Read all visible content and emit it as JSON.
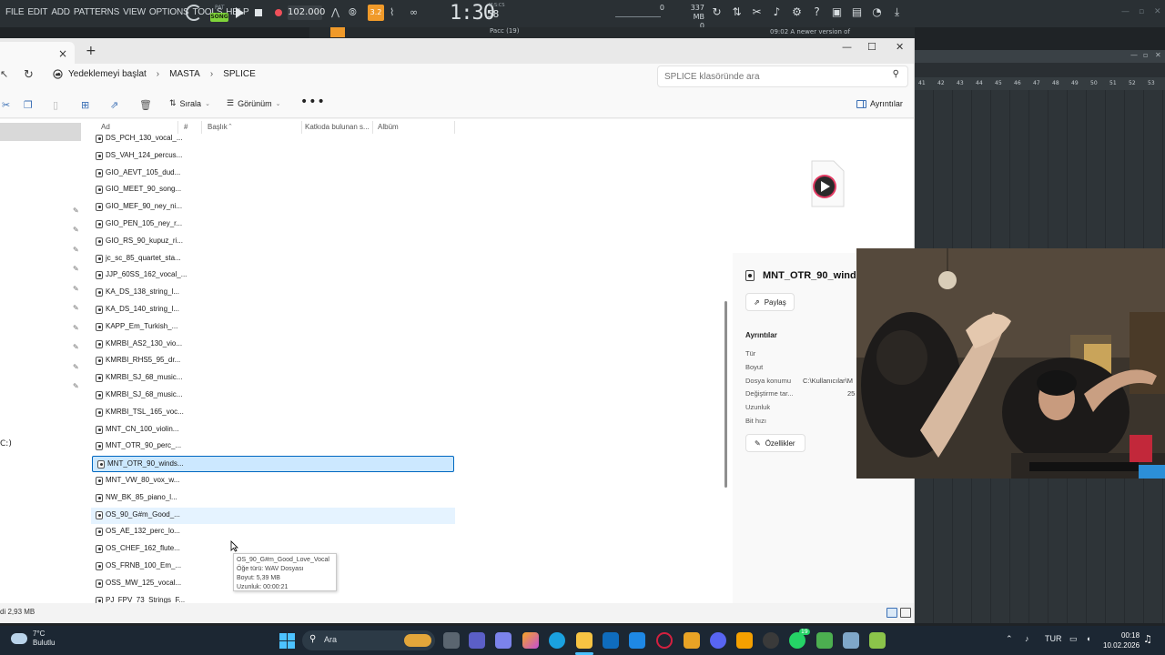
{
  "fl": {
    "menu": [
      "FILE",
      "EDIT",
      "ADD",
      "PATTERNS",
      "VIEW",
      "OPTIONS",
      "TOOLS",
      "HELP"
    ],
    "pat_label": "PAT",
    "song_label": "SONG",
    "tempo": "102.000",
    "snap_label": "3.2",
    "time_main": "1:30",
    "time_sec": "58",
    "time_unit": "M:S:CS",
    "cpu_top": "0",
    "cpu_bottom": "0",
    "memory": "337 MB",
    "memory_sub": "0",
    "notice_time": "09:02",
    "notice_text": "A newer version of",
    "pattern_label": "Pacc (19)",
    "ruler": [
      "41",
      "42",
      "43",
      "44",
      "45",
      "46",
      "47",
      "48",
      "49",
      "50",
      "51",
      "52",
      "53"
    ]
  },
  "explorer": {
    "tab_close": "×",
    "tab_new": "+",
    "breadcrumbs": [
      "Yedeklemeyi başlat",
      "MASTA",
      "SPLICE"
    ],
    "search_placeholder": "SPLICE klasöründe ara",
    "cmd": {
      "sort": "Sırala",
      "view": "Görünüm",
      "more": "•••",
      "details": "Ayrıntılar"
    },
    "columns": {
      "name": "Ad",
      "number": "#",
      "title": "Başlık",
      "artists": "Katkıda bulunan s...",
      "album": "Albüm"
    },
    "files": [
      "DS_PCH_130_vocal_...",
      "DS_VAH_124_percus...",
      "GIO_AEVT_105_dud...",
      "GIO_MEET_90_song...",
      "GIO_MEF_90_ney_ni...",
      "GIO_PEN_105_ney_r...",
      "GIO_RS_90_kupuz_ri...",
      "jc_sc_85_quartet_sta...",
      "JJP_60SS_162_vocal_...",
      "KA_DS_138_string_l...",
      "KA_DS_140_string_l...",
      "KAPP_Em_Turkish_...",
      "KMRBI_AS2_130_vio...",
      "KMRBI_RHS5_95_dr...",
      "KMRBI_SJ_68_music...",
      "KMRBI_SJ_68_music...",
      "KMRBI_TSL_165_voc...",
      "MNT_CN_100_violin...",
      "MNT_OTR_90_perc_...",
      "MNT_OTR_90_winds...",
      "MNT_VW_80_vox_w...",
      "NW_BK_85_piano_l...",
      "OS_90_G#m_Good_...",
      "OS_AE_132_perc_lo...",
      "OS_CHEF_162_flute...",
      "OS_FRNB_100_Em_...",
      "OSS_MW_125_vocal...",
      "PJ_FPV_73_Strings_F..."
    ],
    "selected_index": 19,
    "hover_index": 22,
    "tooltip": [
      "OS_90_G#m_Good_Love_Vocal",
      "Öğe türü: WAV Dosyası",
      "Boyut: 5,39 MB",
      "Uzunluk: 00:00:21"
    ],
    "left_drive_label": "C:)",
    "details": {
      "filename": "MNT_OTR_90_winds",
      "share": "Paylaş",
      "section": "Ayrıntılar",
      "props": [
        {
          "label": "Tür",
          "value": ""
        },
        {
          "label": "Boyut",
          "value": ""
        },
        {
          "label": "Dosya konumu",
          "value": "C:\\Kullanıcılar\\M"
        },
        {
          "label": "Değiştirme tar...",
          "value": "25"
        },
        {
          "label": "Uzunluk",
          "value": ""
        },
        {
          "label": "Bit hızı",
          "value": ""
        }
      ],
      "properties_btn": "Özellikler"
    },
    "status": "di  2,93 MB"
  },
  "taskbar": {
    "temp": "7°C",
    "weather": "Bulutlu",
    "search": "Ara",
    "lang": "TUR",
    "time": "00:18",
    "date": "10.02.2026",
    "badge": "19"
  }
}
